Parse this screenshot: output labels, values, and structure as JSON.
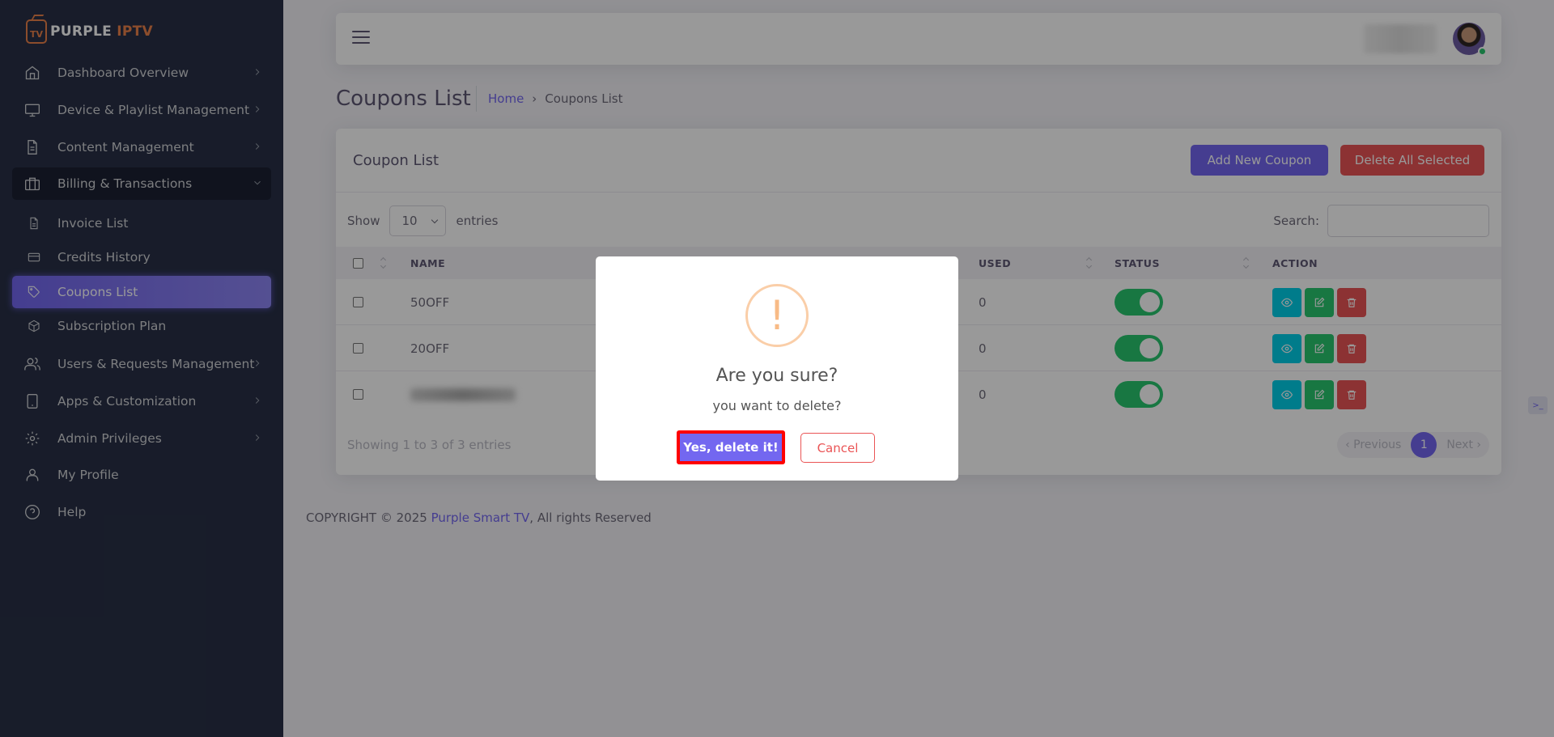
{
  "brand": {
    "name_white": "PURPLE",
    "name_orange": "IPTV",
    "tv_mark": "TV"
  },
  "sidebar": {
    "items": [
      {
        "label": "Dashboard Overview",
        "icon": "home-icon"
      },
      {
        "label": "Device & Playlist Management",
        "icon": "monitor-icon"
      },
      {
        "label": "Content Management",
        "icon": "file-text-icon"
      },
      {
        "label": "Billing & Transactions",
        "icon": "briefcase-icon"
      },
      {
        "label": "Users & Requests Management",
        "icon": "users-icon"
      },
      {
        "label": "Apps & Customization",
        "icon": "tablet-icon"
      },
      {
        "label": "Admin Privileges",
        "icon": "settings-icon"
      },
      {
        "label": "My Profile",
        "icon": "user-icon"
      },
      {
        "label": "Help",
        "icon": "help-circle-icon"
      }
    ],
    "billing_sub": [
      {
        "label": "Invoice List",
        "icon": "file-icon"
      },
      {
        "label": "Credits History",
        "icon": "credit-card-icon"
      },
      {
        "label": "Coupons List",
        "icon": "tag-icon"
      },
      {
        "label": "Subscription Plan",
        "icon": "box-icon"
      }
    ]
  },
  "header": {
    "page_title": "Coupons List",
    "breadcrumb_home": "Home",
    "breadcrumb_current": "Coupons List"
  },
  "card": {
    "title": "Coupon List",
    "add_button": "Add New Coupon",
    "delete_all_button": "Delete All Selected",
    "show_label": "Show",
    "entries_value": "10",
    "entries_label": "entries",
    "search_label": "Search:",
    "columns": {
      "name": "NAME",
      "used": "USED",
      "status": "STATUS",
      "action": "ACTION"
    },
    "rows": [
      {
        "name": "50OFF",
        "used": "0",
        "status": "on"
      },
      {
        "name": "20OFF",
        "used": "0",
        "status": "on"
      },
      {
        "name": "",
        "used": "0",
        "status": "on"
      }
    ],
    "showing_text": "Showing 1 to 3 of 3 entries",
    "pager": {
      "prev": "‹ Previous",
      "current": "1",
      "next": "Next ›"
    }
  },
  "footer": {
    "prefix": "COPYRIGHT © 2025 ",
    "link": "Purple Smart TV",
    "suffix": ", All rights Reserved"
  },
  "modal": {
    "icon_glyph": "!",
    "title": "Are you sure?",
    "text": "you want to delete?",
    "confirm": "Yes, delete it!",
    "cancel": "Cancel"
  },
  "colors": {
    "primary": "#7367f0",
    "danger": "#ea5455",
    "success": "#28c76f",
    "info": "#00cfe8",
    "sidebar_bg": "#283046",
    "warning_ring": "#facea8"
  }
}
